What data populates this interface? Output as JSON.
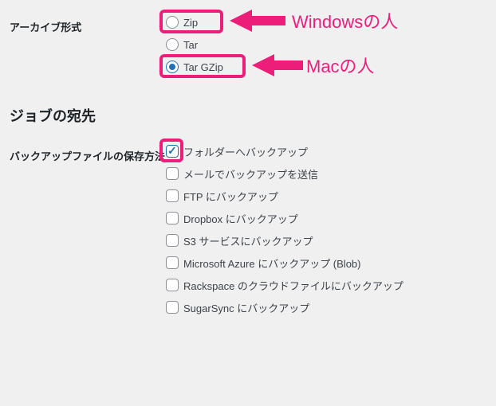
{
  "archive": {
    "label": "アーカイブ形式",
    "options": {
      "zip": "Zip",
      "tar": "Tar",
      "targzip": "Tar GZip"
    },
    "selected": "targzip"
  },
  "section_heading": "ジョブの宛先",
  "destination": {
    "label": "バックアップファイルの保存方法",
    "options": {
      "folder": "フォルダーへバックアップ",
      "mail": "メールでバックアップを送信",
      "ftp": "FTP にバックアップ",
      "dropbox": "Dropbox にバックアップ",
      "s3": "S3 サービスにバックアップ",
      "azure": "Microsoft Azure にバックアップ (Blob)",
      "rackspace": "Rackspace のクラウドファイルにバックアップ",
      "sugarsync": "SugarSync にバックアップ"
    },
    "checked": {
      "folder": true
    }
  },
  "annotations": {
    "windows": "Windowsの人",
    "mac": "Macの人"
  },
  "colors": {
    "accent": "#ed1e79",
    "check": "#2271b1"
  }
}
